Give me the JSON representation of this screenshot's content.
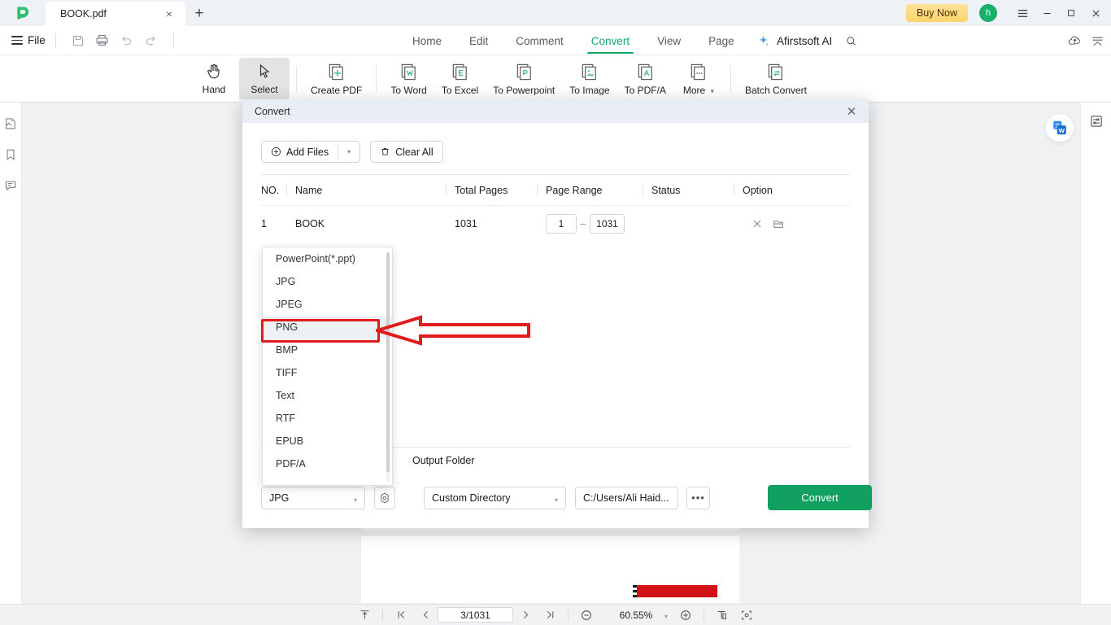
{
  "titlebar": {
    "tab_title": "BOOK.pdf",
    "close_tab": "×",
    "new_tab": "+",
    "buy_now": "Buy Now",
    "avatar_initial": "h",
    "menu_icon": "hamburger-icon",
    "minimize": "—",
    "maximize": "□",
    "close": "✕"
  },
  "menubar": {
    "file_label": "File",
    "icons": [
      "save-icon",
      "print-icon",
      "undo-icon",
      "redo-icon"
    ],
    "tabs": [
      {
        "label": "Home",
        "active": false
      },
      {
        "label": "Edit",
        "active": false
      },
      {
        "label": "Comment",
        "active": false
      },
      {
        "label": "Convert",
        "active": true
      },
      {
        "label": "View",
        "active": false
      },
      {
        "label": "Page",
        "active": false
      }
    ],
    "ai_label": "Afirstsoft AI",
    "search_icon": "search-icon",
    "cloud_icon": "cloud-upload-icon",
    "collapse_icon": "collapse-ribbon-icon",
    "accent_color": "#0fa968"
  },
  "ribbon": {
    "items": [
      {
        "label": "Hand",
        "icon": "hand-icon",
        "selected": false
      },
      {
        "label": "Select",
        "icon": "cursor-icon",
        "selected": true
      },
      {
        "label": "Create PDF",
        "icon": "create-pdf-icon",
        "selected": false
      },
      {
        "label": "To Word",
        "icon": "to-word-icon",
        "selected": false
      },
      {
        "label": "To Excel",
        "icon": "to-excel-icon",
        "selected": false
      },
      {
        "label": "To Powerpoint",
        "icon": "to-powerpoint-icon",
        "selected": false
      },
      {
        "label": "To Image",
        "icon": "to-image-icon",
        "selected": false
      },
      {
        "label": "To PDF/A",
        "icon": "to-pdfa-icon",
        "selected": false
      },
      {
        "label": "More",
        "icon": "more-icon",
        "selected": false,
        "has_caret": true
      },
      {
        "label": "Batch Convert",
        "icon": "batch-convert-icon",
        "selected": false
      }
    ],
    "icon_accent": "#3fb984"
  },
  "left_rail": {
    "items": [
      {
        "name": "thumbnails-icon"
      },
      {
        "name": "bookmarks-icon"
      },
      {
        "name": "comments-icon"
      }
    ]
  },
  "right_rail": {
    "items": [
      {
        "name": "properties-icon"
      }
    ],
    "translate_badge": "translate-to-word-icon"
  },
  "dialog": {
    "title": "Convert",
    "close_label": "✕",
    "add_files": "Add Files",
    "clear_all": "Clear All",
    "table": {
      "headers": [
        "NO.",
        "Name",
        "Total Pages",
        "Page Range",
        "Status",
        "Option"
      ],
      "rows": [
        {
          "no": "1",
          "name": "BOOK",
          "total_pages": "1031",
          "page_from": "1",
          "page_dash": "–",
          "page_to": "1031",
          "status": "",
          "remove_icon": "remove-file-icon",
          "folder_icon": "open-folder-icon"
        }
      ]
    },
    "output_folder_label": "Output Folder",
    "format_value": "JPG",
    "settings_icon": "format-settings-icon",
    "directory_mode": "Custom Directory",
    "output_path": "C:/Users/Ali Haid...",
    "browse_label": "•••",
    "convert_label": "Convert",
    "convert_color": "#11a05f"
  },
  "dropdown": {
    "options": [
      {
        "label": "PowerPoint(*.ppt)",
        "selected": false
      },
      {
        "label": "JPG",
        "selected": false
      },
      {
        "label": "JPEG",
        "selected": false
      },
      {
        "label": "PNG",
        "selected": true
      },
      {
        "label": "BMP",
        "selected": false
      },
      {
        "label": "TIFF",
        "selected": false
      },
      {
        "label": "Text",
        "selected": false
      },
      {
        "label": "RTF",
        "selected": false
      },
      {
        "label": "EPUB",
        "selected": false
      },
      {
        "label": "PDF/A",
        "selected": false
      }
    ]
  },
  "annotations": {
    "highlight_color": "#e01b1b",
    "highlight_target": "PNG",
    "arrow_direction": "left"
  },
  "statusbar": {
    "fit_icon": "scroll-top-icon",
    "first_page_icon": "first-page-icon",
    "prev_page_icon": "prev-page-icon",
    "page_value": "3/1031",
    "next_page_icon": "next-page-icon",
    "last_page_icon": "last-page-icon",
    "zoom_out_icon": "zoom-out-icon",
    "zoom_value": "60.55%",
    "zoom_in_icon": "zoom-in-icon",
    "fit_page_icon": "fit-page-icon",
    "fit_width_icon": "fit-width-icon"
  }
}
